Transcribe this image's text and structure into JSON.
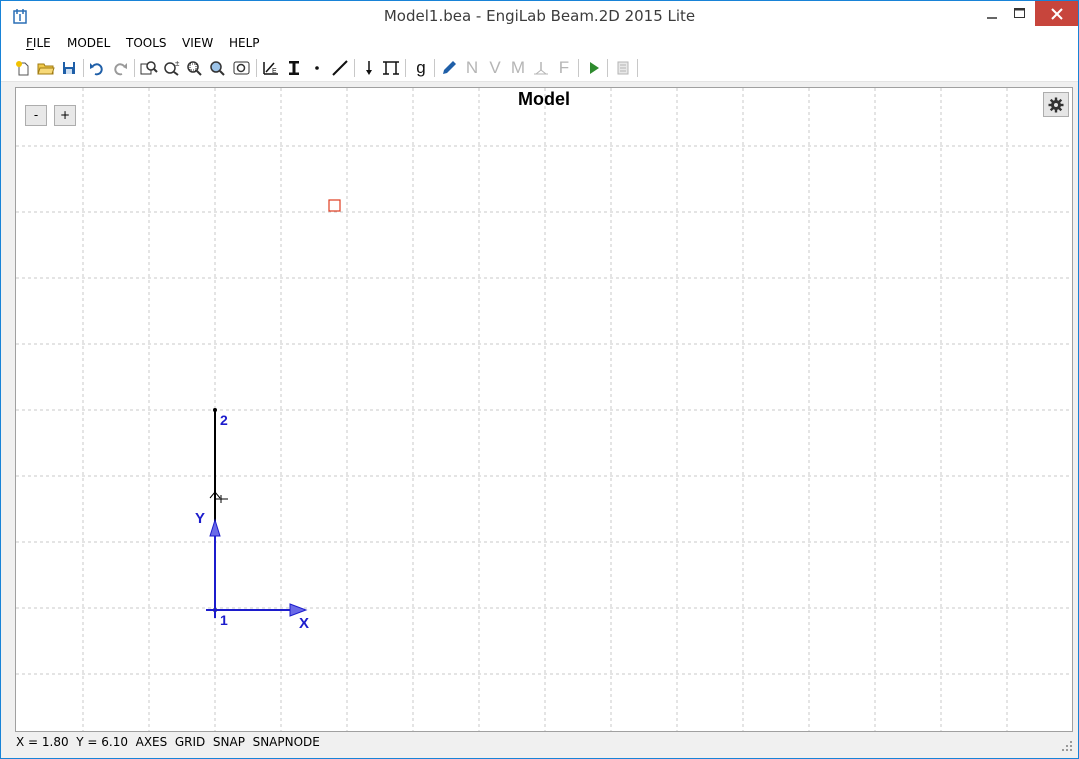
{
  "window": {
    "title": "Model1.bea - EngiLab Beam.2D 2015 Lite"
  },
  "menu": {
    "items": [
      {
        "label": "FILE",
        "underline": "F"
      },
      {
        "label": "MODEL"
      },
      {
        "label": "TOOLS"
      },
      {
        "label": "VIEW"
      },
      {
        "label": "HELP"
      }
    ]
  },
  "toolbar": {
    "letters": {
      "g": "g",
      "n": "N",
      "v": "V",
      "m": "M",
      "f": "F"
    },
    "icons": [
      "new-icon",
      "open-icon",
      "save-icon",
      "undo-icon",
      "redo-icon",
      "zoom-extents-icon",
      "zoom-in-out-icon",
      "zoom-window-icon",
      "zoom-icon",
      "zoom-fit-icon",
      "material-icon",
      "section-icon",
      "node-icon",
      "element-icon",
      "load-icon",
      "support-icon",
      "g-icon",
      "edit-icon",
      "n-diagram-icon",
      "v-diagram-icon",
      "m-diagram-icon",
      "reactions-icon",
      "f-icon",
      "run-icon",
      "report-icon"
    ],
    "colors": {
      "accent": "#1f5fa8",
      "run": "#2e8b2e",
      "disabled": "#b5b5b5"
    }
  },
  "canvas": {
    "title": "Model",
    "zoom_out": "-",
    "zoom_in": "+",
    "settings": "gear-icon",
    "nodes": [
      {
        "label": "1"
      },
      {
        "label": "2"
      }
    ],
    "axes": {
      "x_label": "X",
      "y_label": "Y"
    },
    "colors": {
      "axis": "#1c1ccc",
      "beam": "#000000",
      "selection": "#e03c20",
      "grid": "#c8c8c8"
    }
  },
  "status": {
    "text": "X = 1.80  Y = 6.10  AXES  GRID  SNAP  SNAPNODE"
  }
}
